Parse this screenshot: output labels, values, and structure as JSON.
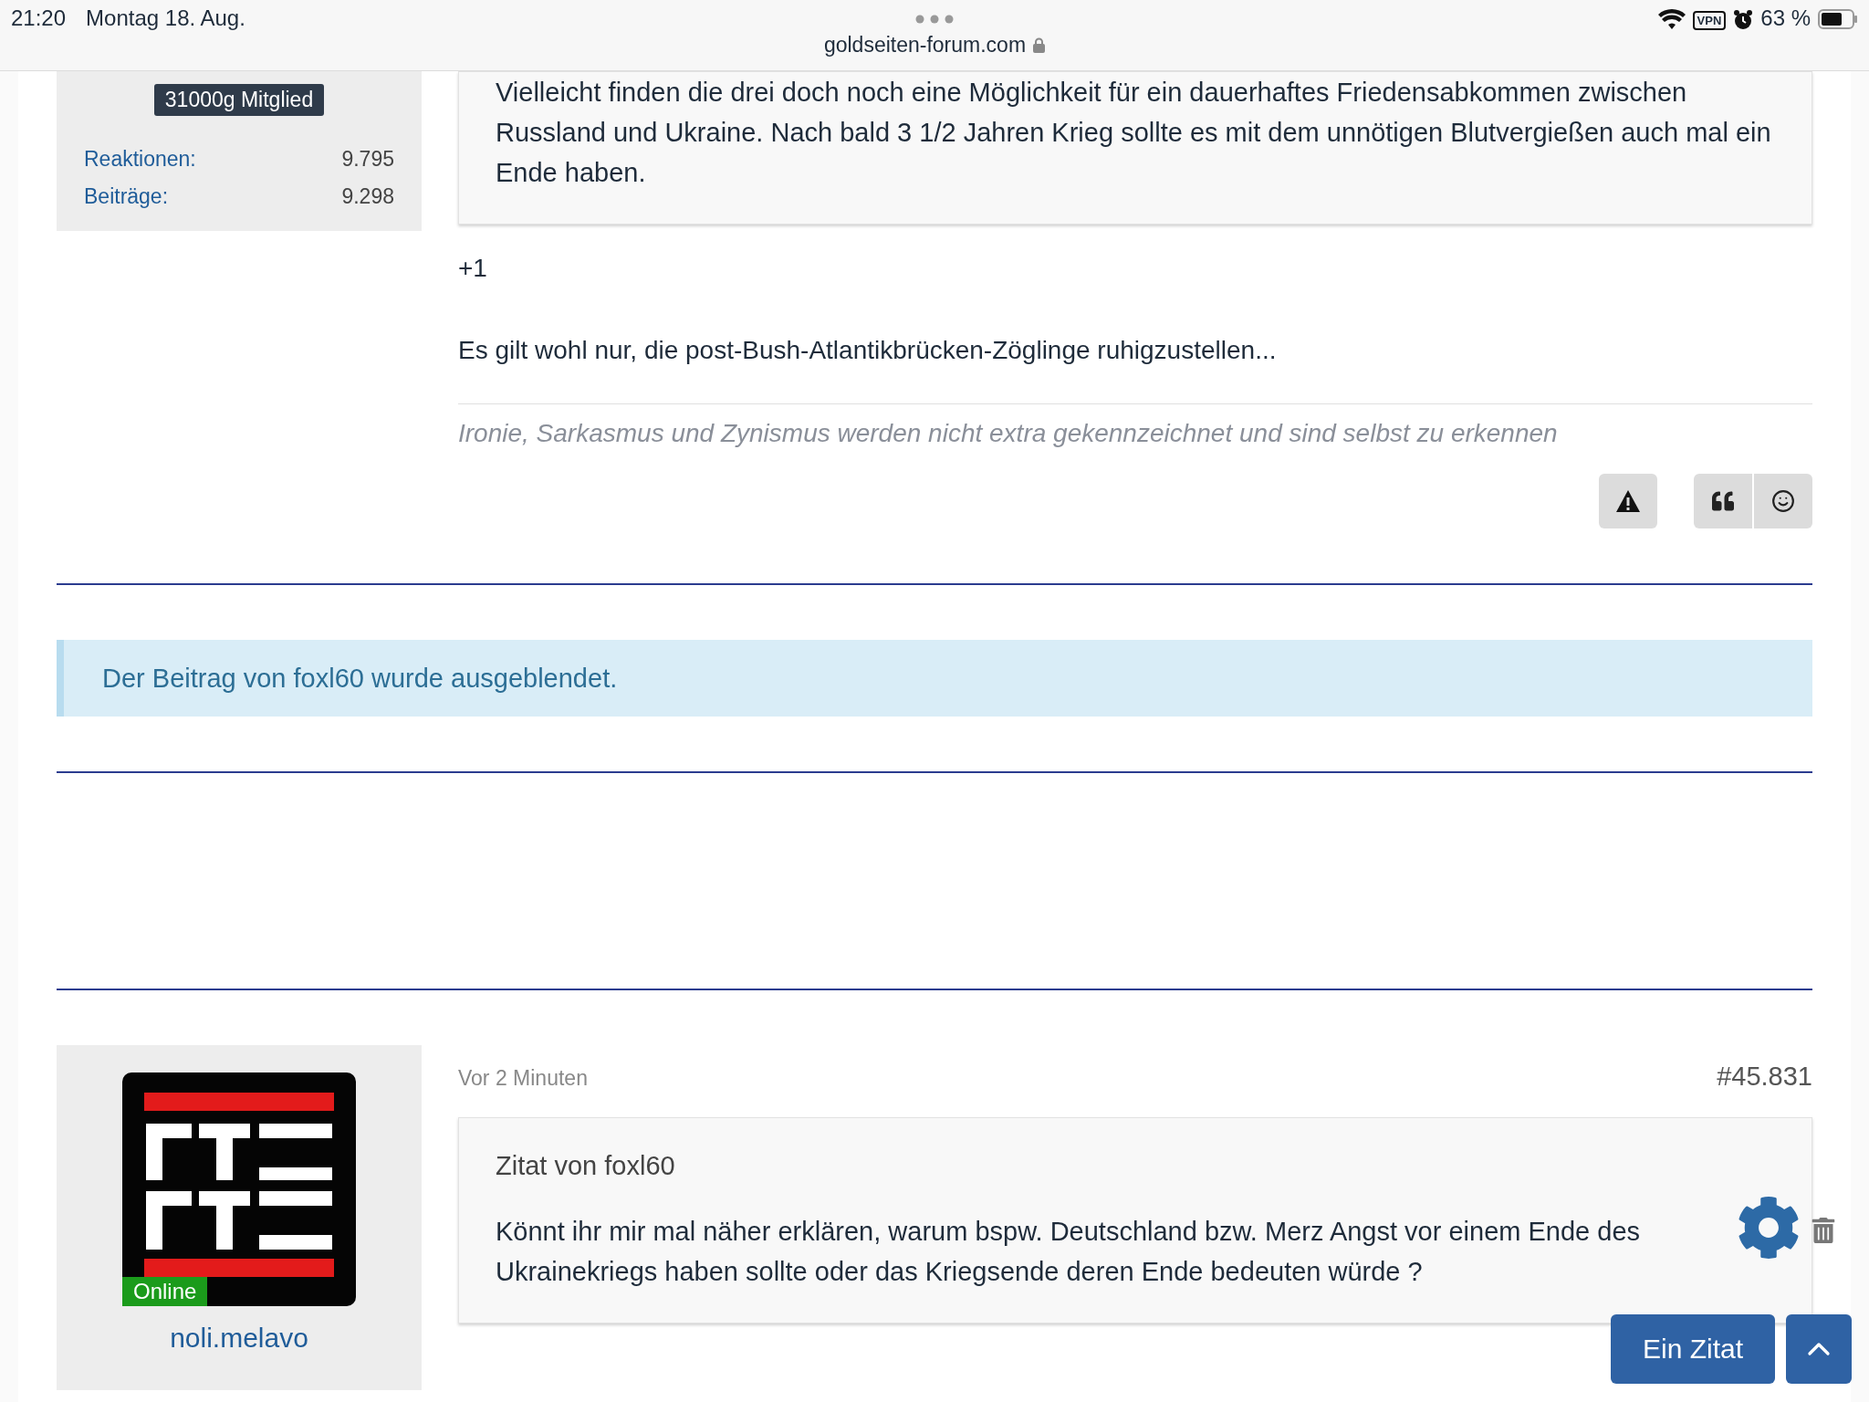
{
  "status_bar": {
    "time": "21:20",
    "date": "Montag 18. Aug.",
    "url": "goldseiten-forum.com",
    "vpn": "VPN",
    "battery": "63 %"
  },
  "post_1": {
    "user": {
      "badge": "31000g Mitglied",
      "stats": [
        {
          "label": "Reaktionen:",
          "value": "9.795"
        },
        {
          "label": "Beiträge:",
          "value": "9.298"
        }
      ]
    },
    "quote": "Vielleicht finden die drei doch noch eine Möglichkeit für ein dauerhaftes Friedensabkommen zwischen Russland und Ukraine. Nach bald 3 1/2 Jahren Krieg sollte es mit dem unnötigen Blutvergießen auch mal ein Ende haben.",
    "paragraphs": [
      "+1",
      "Es gilt wohl nur, die post-Bush-Atlantikbrücken-Zöglinge ruhigzustellen..."
    ],
    "signature": "Ironie, Sarkasmus und Zynismus werden nicht extra gekennzeichnet und sind selbst zu erkennen"
  },
  "hidden_notice": "Der Beitrag von foxl60 wurde ausgeblendet.",
  "post_2": {
    "user": {
      "online": true,
      "online_label": "Online",
      "name": "noli.melavo"
    },
    "time": "Vor 2 Minuten",
    "number": "#45.831",
    "quote": {
      "author": "Zitat von foxl60",
      "text": "Könnt ihr mir mal näher erklären, warum bspw. Deutschland bzw. Merz Angst vor einem Ende des Ukrainekriegs haben sollte oder das Kriegsende deren Ende bedeuten würde ?"
    }
  },
  "floating": {
    "quote_button": "Ein Zitat"
  }
}
